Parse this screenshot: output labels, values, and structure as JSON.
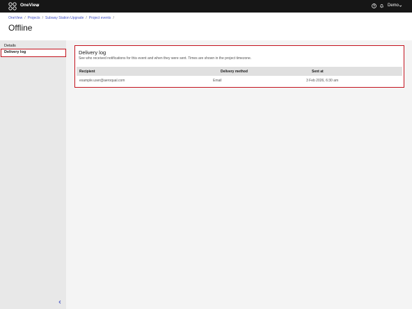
{
  "topbar": {
    "app_name": "OneView",
    "user_name": "Demo"
  },
  "breadcrumb": {
    "items": [
      "OneView",
      "Projects",
      "Subway Station Upgrade",
      "Project events"
    ],
    "separator": "/"
  },
  "page": {
    "title": "Offline"
  },
  "sidebar": {
    "items": [
      {
        "label": "Details"
      },
      {
        "label": "Delivery log"
      }
    ]
  },
  "delivery_log": {
    "title": "Delivery log",
    "description": "See who received notifications for this event and when they were sent. Times are shown in the project timezone.",
    "columns": [
      "Recipient",
      "Delivery method",
      "Sent at"
    ],
    "rows": [
      {
        "recipient": "example.user@aeroqual.com",
        "method": "Email",
        "sent_at": "3 Feb 2026, 6:30 am"
      }
    ]
  },
  "colors": {
    "topbar_bg": "#161616",
    "link": "#4453c4",
    "highlight_border": "#c3111c"
  },
  "icons": {
    "logo": "oneview-logo-icon",
    "help": "help-icon",
    "notifications": "bell-icon",
    "collapse": "chevron-left-icon"
  }
}
